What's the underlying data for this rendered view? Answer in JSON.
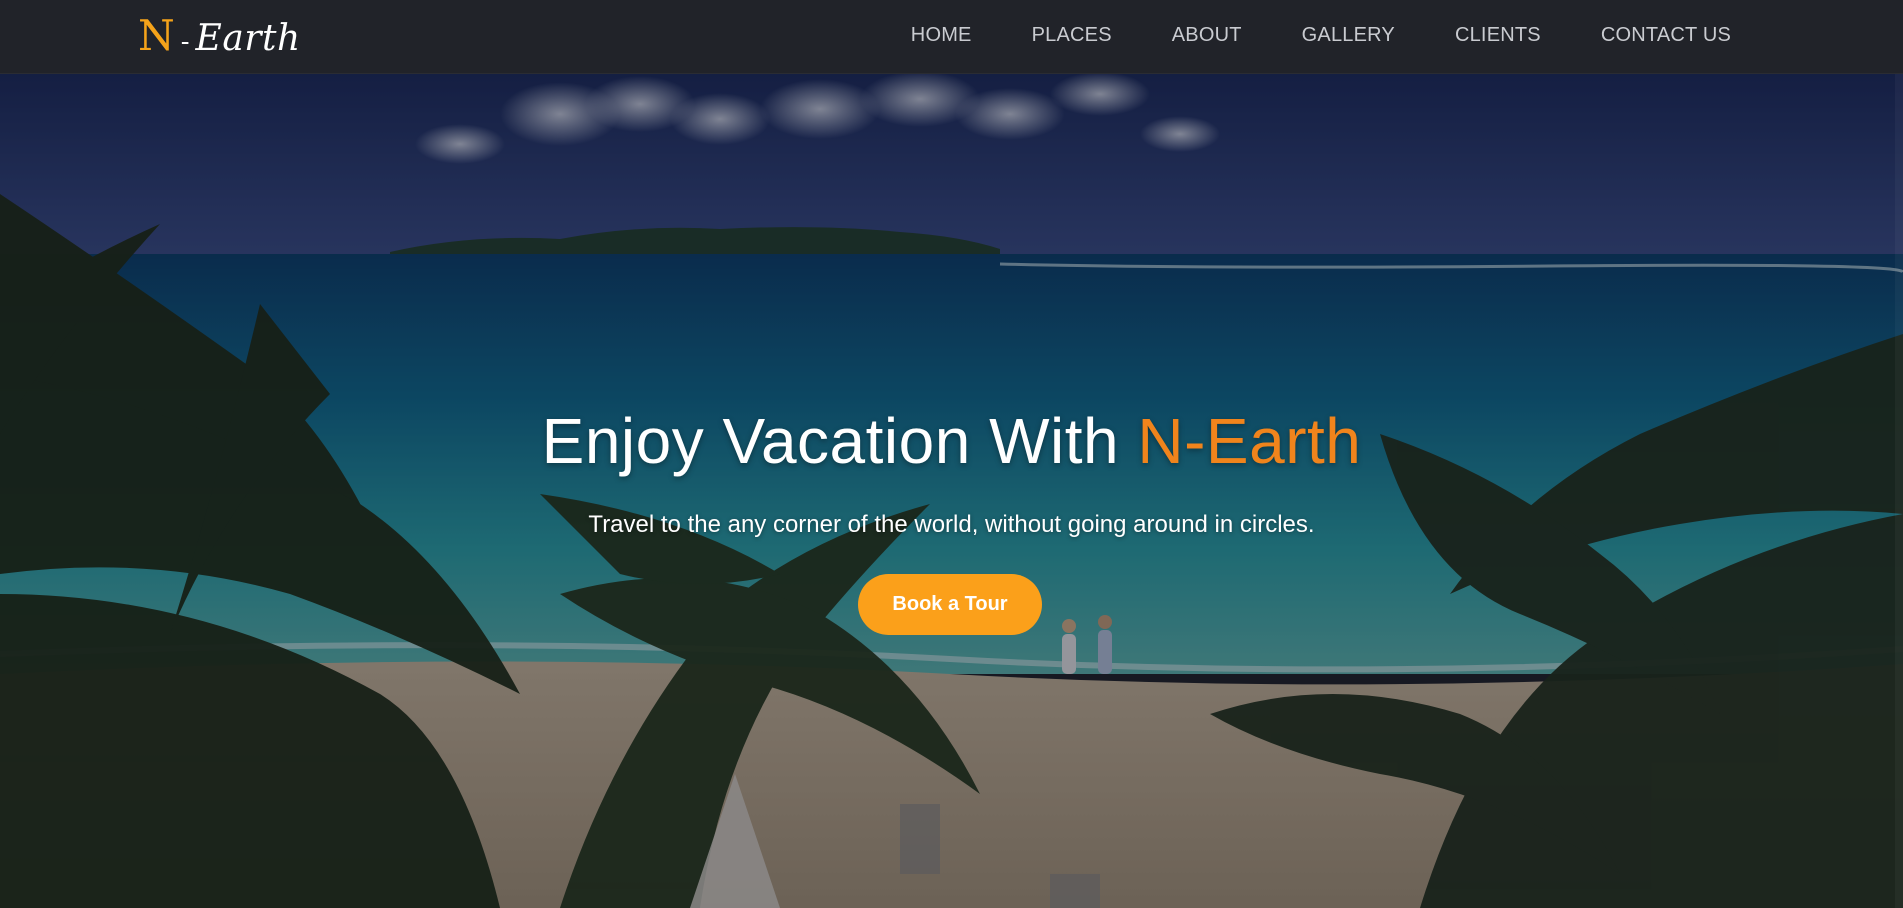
{
  "brand": {
    "mark": "N",
    "separator": "-",
    "word": "Earth"
  },
  "nav": {
    "items": [
      {
        "label": "HOME"
      },
      {
        "label": "PLACES"
      },
      {
        "label": "ABOUT"
      },
      {
        "label": "GALLERY"
      },
      {
        "label": "CLIENTS"
      },
      {
        "label": "CONTACT US"
      }
    ]
  },
  "hero": {
    "title_prefix": "Enjoy Vacation With ",
    "title_accent": "N-Earth",
    "subtitle": "Travel to the any corner of the world, without going around in circles.",
    "cta_label": "Book a Tour"
  },
  "colors": {
    "accent": "#f5a31a",
    "title_accent": "#f0841c",
    "nav_bg": "#212329",
    "nav_text": "#c9cbd0",
    "cta_bg": "#fba01a"
  }
}
